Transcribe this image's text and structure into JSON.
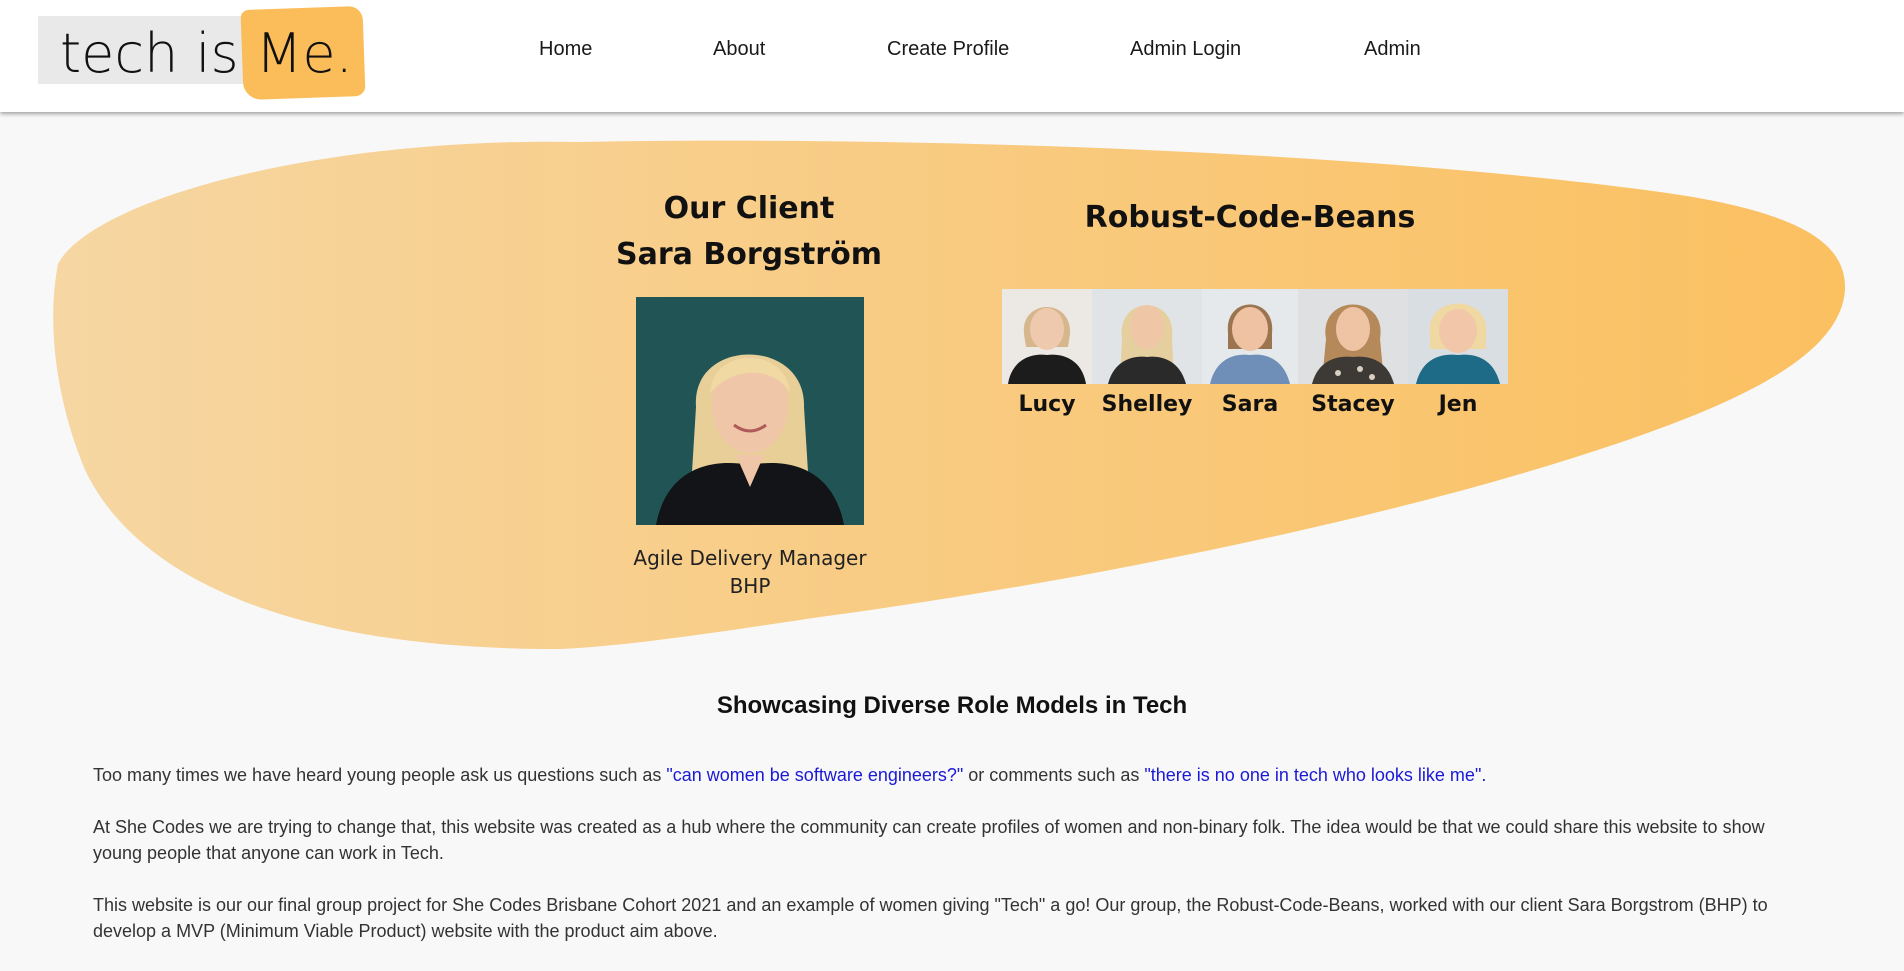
{
  "logo": {
    "text_plain": "tech is ",
    "text_accent": "Me."
  },
  "nav": {
    "items": [
      {
        "label": "Home"
      },
      {
        "label": "About"
      },
      {
        "label": "Create Profile"
      },
      {
        "label": "Admin Login"
      },
      {
        "label": "Admin"
      }
    ]
  },
  "client": {
    "heading_line1": "Our Client",
    "heading_line2": "Sara Borgström",
    "role": "Agile Delivery Manager",
    "company": "BHP"
  },
  "team": {
    "title": "Robust-Code-Beans",
    "members": [
      {
        "name": "Lucy"
      },
      {
        "name": "Shelley"
      },
      {
        "name": "Sara"
      },
      {
        "name": "Stacey"
      },
      {
        "name": "Jen"
      }
    ]
  },
  "content": {
    "headline": "Showcasing Diverse Role Models in Tech",
    "p1_before": "Too many times we have heard young people ask us questions such as ",
    "p1_quote1": "\"can women be software engineers?\"",
    "p1_middle": " or comments such as ",
    "p1_quote2": "\"there is no one in tech who looks like me\".",
    "p2": "At She Codes we are trying to change that, this website was created as a hub where the community can create profiles of women and non-binary folk. The idea would be that we could share this website to show young people that anyone can work in Tech.",
    "p3": "This website is our our final group project for She Codes Brisbane Cohort 2021 and an example of women giving \"Tech\" a go! Our group, the Robust-Code-Beans, worked with our client Sara Borgstrom (BHP) to develop a MVP (Minimum Viable Product) website with the product aim above."
  },
  "colors": {
    "accent": "#fbbd59",
    "blob_light": "#f6d6a2",
    "blob_dark": "#fbc060",
    "quote": "#1a1ad6"
  }
}
